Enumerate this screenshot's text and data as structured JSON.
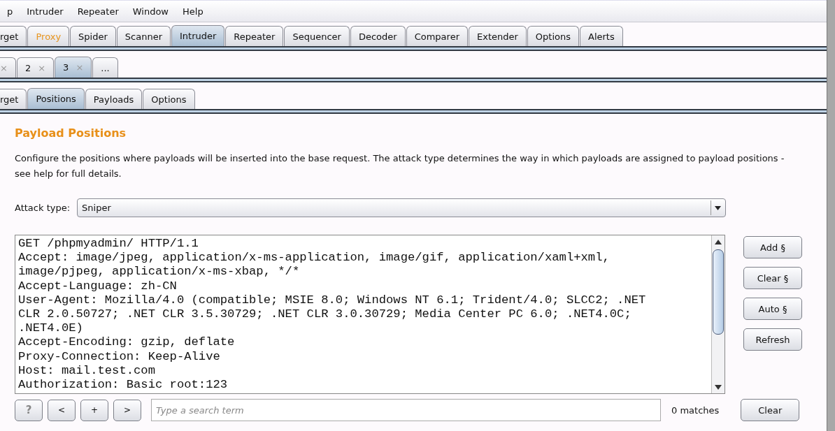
{
  "menu": [
    "p",
    "Intruder",
    "Repeater",
    "Window",
    "Help"
  ],
  "main_tabs": [
    {
      "label": "rget",
      "selected": false,
      "highlighted": false
    },
    {
      "label": "Proxy",
      "selected": false,
      "highlighted": true
    },
    {
      "label": "Spider",
      "selected": false,
      "highlighted": false
    },
    {
      "label": "Scanner",
      "selected": false,
      "highlighted": false
    },
    {
      "label": "Intruder",
      "selected": true,
      "highlighted": false
    },
    {
      "label": "Repeater",
      "selected": false,
      "highlighted": false
    },
    {
      "label": "Sequencer",
      "selected": false,
      "highlighted": false
    },
    {
      "label": "Decoder",
      "selected": false,
      "highlighted": false
    },
    {
      "label": "Comparer",
      "selected": false,
      "highlighted": false
    },
    {
      "label": "Extender",
      "selected": false,
      "highlighted": false
    },
    {
      "label": "Options",
      "selected": false,
      "highlighted": false
    },
    {
      "label": "Alerts",
      "selected": false,
      "highlighted": false
    }
  ],
  "attack_tabs": [
    {
      "close": "×",
      "selected": false
    },
    {
      "label": "2",
      "close": "×",
      "selected": false
    },
    {
      "label": "3",
      "close": "×",
      "selected": true
    },
    {
      "label": "...",
      "selected": false
    }
  ],
  "inner_tabs": [
    {
      "label": "rget",
      "selected": false
    },
    {
      "label": "Positions",
      "selected": true
    },
    {
      "label": "Payloads",
      "selected": false
    },
    {
      "label": "Options",
      "selected": false
    }
  ],
  "section": {
    "title": "Payload Positions",
    "description": "Configure the positions where payloads will be inserted into the base request. The attack type determines the way in which payloads are assigned to payload positions - see help for full details.",
    "attack_type_label": "Attack type:",
    "attack_type": "Sniper"
  },
  "request_lines": [
    "GET /phpmyadmin/ HTTP/1.1",
    "Accept: image/jpeg, application/x-ms-application, image/gif, application/xaml+xml,",
    "image/pjpeg, application/x-ms-xbap, */*",
    "Accept-Language: zh-CN",
    "User-Agent: Mozilla/4.0 (compatible; MSIE 8.0; Windows NT 6.1; Trident/4.0; SLCC2; .NET",
    "CLR 2.0.50727; .NET CLR 3.5.30729; .NET CLR 3.0.30729; Media Center PC 6.0; .NET4.0C;",
    ".NET4.0E)",
    "Accept-Encoding: gzip, deflate",
    "Proxy-Connection: Keep-Alive",
    "Host: mail.test.com",
    "Authorization: Basic root:123"
  ],
  "side_buttons": [
    "Add §",
    "Clear §",
    "Auto §",
    "Refresh"
  ],
  "search": {
    "help": "?",
    "prev": "<",
    "add": "+",
    "next": ">",
    "placeholder": "Type a search term",
    "matches": "0 matches",
    "clear": "Clear"
  }
}
